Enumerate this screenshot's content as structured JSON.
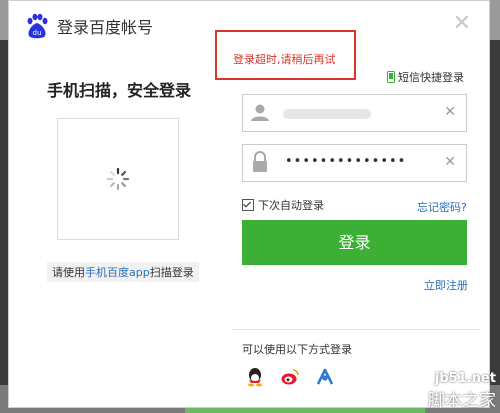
{
  "window": {
    "title": "登录百度帐号",
    "close_icon": "close-icon"
  },
  "qr": {
    "heading": "手机扫描，安全登录",
    "hint_prefix": "请使用",
    "hint_link": "手机百度app",
    "hint_suffix": "扫描登录"
  },
  "error": {
    "message": "登录超时,请稍后再试"
  },
  "sms_login": {
    "label": "短信快捷登录",
    "icon": "phone-icon"
  },
  "form": {
    "username_icon": "user-icon",
    "password_icon": "lock-icon",
    "password_value": "••••••••••••••",
    "remember_label": "下次自动登录",
    "remember_checked": true,
    "forgot_label": "忘记密码?",
    "login_label": "登录",
    "register_label": "立即注册"
  },
  "other_login": {
    "title": "可以使用以下方式登录",
    "providers": [
      "qq-icon",
      "weibo-icon",
      "tieba-icon"
    ]
  },
  "watermark": {
    "site": "jb51.net",
    "text": "脚本之家"
  },
  "colors": {
    "accent_green": "#3cb035",
    "link_blue": "#2a6ebb",
    "error_red": "#d8362a"
  }
}
